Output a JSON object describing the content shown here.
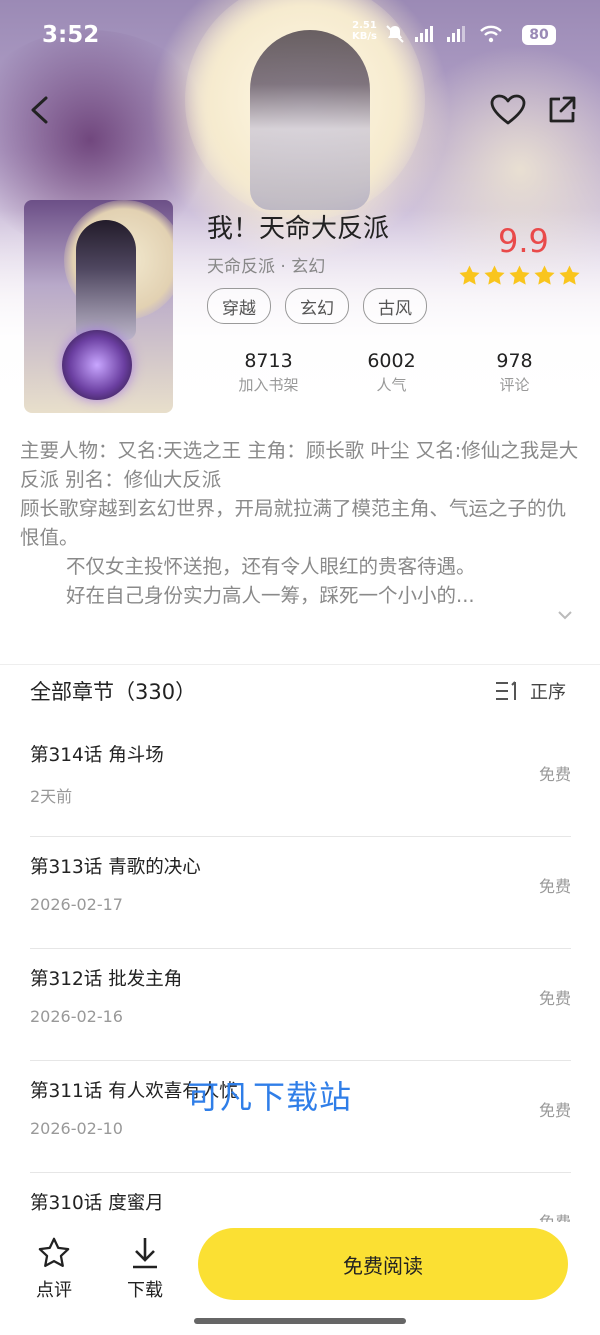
{
  "status_bar": {
    "time": "3:52",
    "net_speed": "2.51",
    "net_unit": "KB/s",
    "signal_1": "5G",
    "signal_2": "5G",
    "battery": "80"
  },
  "book": {
    "title": "我！天命大反派",
    "subtitle": "天命反派 · 玄幻",
    "rating": "9.9",
    "stars": 5,
    "tags": [
      "穿越",
      "玄幻",
      "古风"
    ],
    "stats": [
      {
        "value": "8713",
        "label": "加入书架"
      },
      {
        "value": "6002",
        "label": "人气"
      },
      {
        "value": "978",
        "label": "评论"
      }
    ]
  },
  "description": {
    "line1": "主要人物：又名:天选之王 主角：顾长歌 叶尘  又名:修仙之我是大反派  别名：修仙大反派",
    "line2": "顾长歌穿越到玄幻世界，开局就拉满了模范主角、气运之子的仇恨值。",
    "line3": "不仅女主投怀送抱，还有令人眼红的贵客待遇。",
    "line4": "好在自己身份实力高人一筹，踩死一个小小的..."
  },
  "chapter_list": {
    "header": "全部章节（330）",
    "sort_label": "正序",
    "chapters": [
      {
        "title": "第314话 角斗场",
        "date": "2天前",
        "price": "免费"
      },
      {
        "title": "第313话 青歌的决心",
        "date": "2026-02-17",
        "price": "免费"
      },
      {
        "title": "第312话 批发主角",
        "date": "2026-02-16",
        "price": "免费"
      },
      {
        "title": "第311话 有人欢喜有人忧",
        "date": "2026-02-10",
        "price": "免费"
      },
      {
        "title": "第310话 度蜜月",
        "date": "",
        "price": "免费"
      }
    ]
  },
  "watermark": "可凡下载站",
  "bottom_bar": {
    "review_label": "点评",
    "download_label": "下载",
    "read_button": "免费阅读"
  },
  "colors": {
    "accent_yellow": "#fbe033",
    "rating_red": "#e94a4a",
    "star_yellow": "#f9c51d",
    "watermark_blue": "#2f7ee8"
  }
}
